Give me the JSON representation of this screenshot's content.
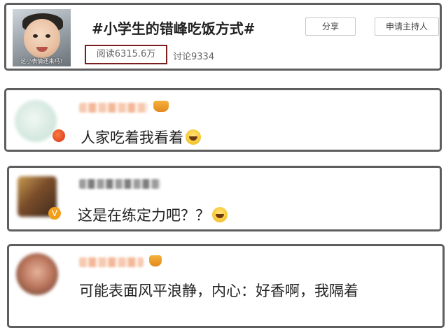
{
  "topic": {
    "title": "#小学生的错峰吃饭方式#",
    "cover_caption": "这小表情还来吗?",
    "read_label": "阅读6315.6万",
    "discuss_label": "讨论9334",
    "share_label": "分享",
    "host_label": "申请主持人"
  },
  "comments": [
    {
      "text": "人家吃着我看着",
      "emoji": "laughing-tears-icon"
    },
    {
      "text": "这是在练定力吧？？",
      "emoji": "laughing-tears-icon"
    },
    {
      "text": "可能表面风平浪静，内心：好香啊，我隔着",
      "emoji": ""
    }
  ],
  "colors": {
    "card_border": "#5e5e5e",
    "read_box_border": "#7a1f1f",
    "badge_orange": "#f2a01c"
  }
}
